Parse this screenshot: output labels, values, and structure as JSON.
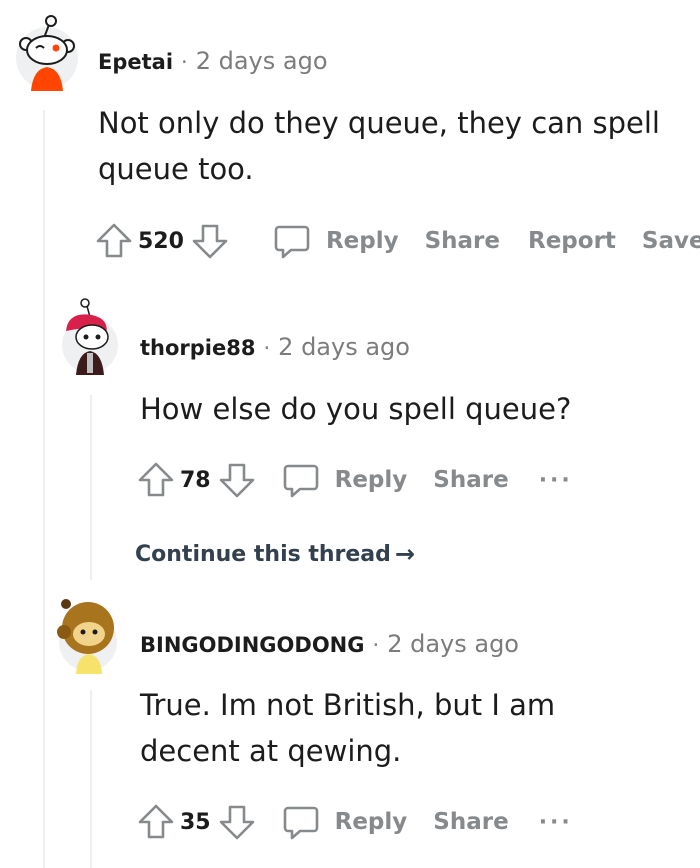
{
  "comments": [
    {
      "author": "Epetai",
      "separator": "·",
      "time": "2 days ago",
      "lines": [
        "Not only do they queue, they can spell",
        "queue too."
      ],
      "score": "520",
      "actions": {
        "reply": "Reply",
        "share": "Share",
        "report": "Report",
        "save": "Save"
      }
    },
    {
      "author": "thorpie88",
      "separator": "·",
      "time": "2 days ago",
      "lines": [
        "How else do you spell queue?"
      ],
      "score": "78",
      "actions": {
        "reply": "Reply",
        "share": "Share",
        "more": "···"
      }
    },
    {
      "author": "BINGODINGODONG",
      "separator": "·",
      "time": "2 days ago",
      "lines": [
        "True. Im not British, but I am",
        "decent at qewing."
      ],
      "score": "35",
      "actions": {
        "reply": "Reply",
        "share": "Share",
        "more": "···"
      }
    }
  ],
  "continue_thread": {
    "label": "Continue this thread",
    "arrow": "→"
  },
  "colors": {
    "text": "#1c1c1c",
    "meta_gray": "#7c7c7c",
    "action_gray": "#878a8c",
    "thread_line": "#edeff1",
    "continue_link": "#33414f"
  },
  "icons": [
    "upvote-icon",
    "downvote-icon",
    "comment-bubble-icon",
    "more-options-icon",
    "arrow-right-icon"
  ]
}
